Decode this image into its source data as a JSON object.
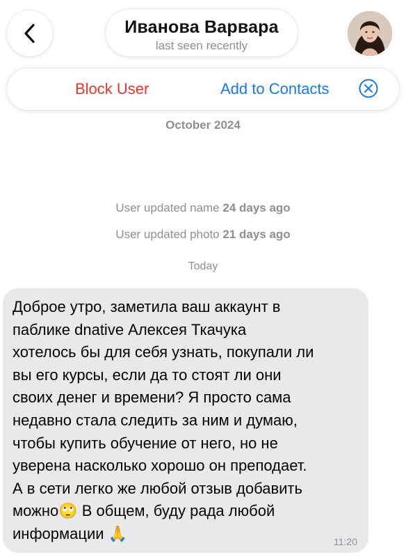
{
  "header": {
    "back_icon": "chevron-left-icon",
    "contact_name": "Иванова Варвара",
    "status": "last seen recently",
    "avatar_icon": "profile-photo"
  },
  "action_bar": {
    "block_label": "Block User",
    "add_label": "Add to Contacts",
    "close_icon": "close-circle-icon",
    "block_color": "#e0392f",
    "add_color": "#1877f2"
  },
  "chat": {
    "month_header": "October 2024",
    "service_messages": [
      {
        "text": "User updated name ",
        "emphasis": "24 days ago"
      },
      {
        "text": "User updated photo ",
        "emphasis": "21 days ago"
      }
    ],
    "day_header": "Today",
    "message": {
      "text": "Доброе утро, заметила ваш аккаунт в\nпаблике dnative Алексея Ткачука\nхотелось бы для себя узнать, покупали ли\nвы его курсы, если да то стоят ли они\nсвоих денег и времени? Я просто сама\nнедавно стала следить за ним и думаю,\nчтобы купить обучение от него, но не\nуверена насколько хорошо он преподает.\nА в сети легко же любой отзыв добавить\nможно🙄 В общем, буду рада любой\nинформации 🙏",
      "time": "11:20"
    }
  }
}
